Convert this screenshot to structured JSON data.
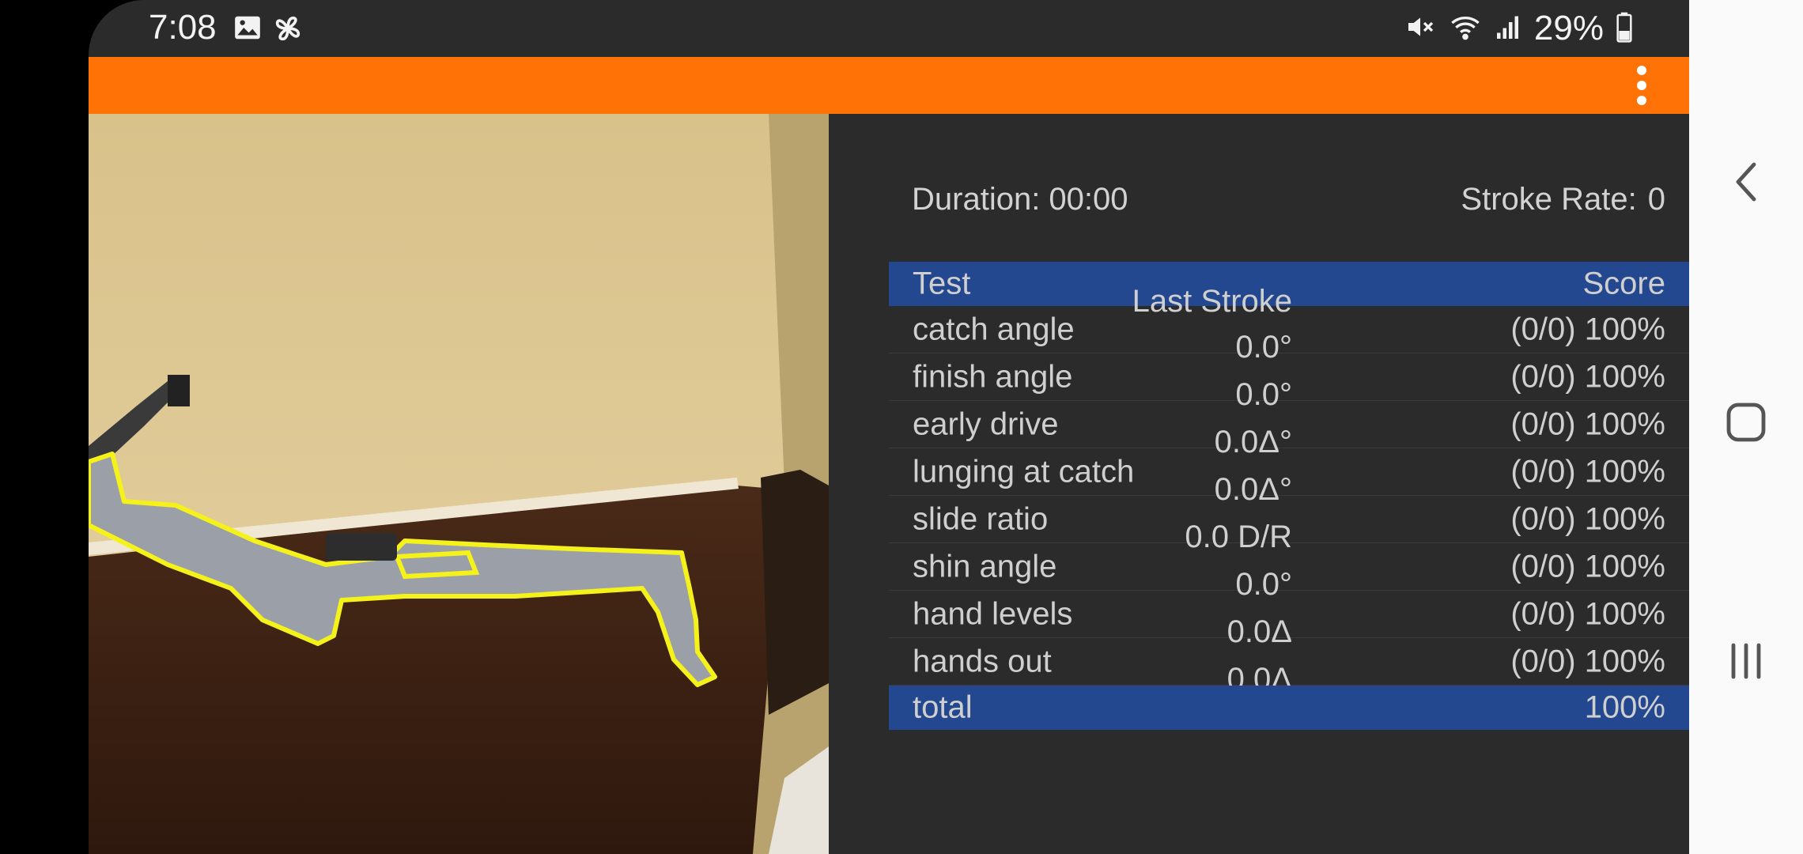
{
  "status_bar": {
    "time": "7:08",
    "battery_percent": "29%",
    "icons": [
      "image-icon",
      "pinwheel-icon",
      "mute-icon",
      "wifi-icon",
      "signal-icon",
      "battery-icon"
    ]
  },
  "toolbar": {
    "accent_color": "#ff7306",
    "menu_icon": "more-vert-icon"
  },
  "stats": {
    "duration_label": "Duration: 00:00",
    "stroke_rate_label": "Stroke Rate:",
    "stroke_rate_value": "0"
  },
  "table": {
    "header_color": "#24488f",
    "headers": {
      "test": "Test",
      "last_stroke": "Last Stroke",
      "score": "Score"
    },
    "rows": [
      {
        "test": "catch angle",
        "last_stroke": "0.0°",
        "score": "(0/0) 100%"
      },
      {
        "test": "finish angle",
        "last_stroke": "0.0°",
        "score": "(0/0) 100%"
      },
      {
        "test": "early drive",
        "last_stroke": "0.0Δ°",
        "score": "(0/0) 100%"
      },
      {
        "test": "lunging at catch",
        "last_stroke": "0.0Δ°",
        "score": "(0/0) 100%"
      },
      {
        "test": "slide ratio",
        "last_stroke": "0.0 D/R",
        "score": "(0/0) 100%"
      },
      {
        "test": "shin angle",
        "last_stroke": "0.0°",
        "score": "(0/0) 100%"
      },
      {
        "test": "hand levels",
        "last_stroke": "0.0Δ",
        "score": "(0/0) 100%"
      },
      {
        "test": "hands out",
        "last_stroke": "0.0Δ",
        "score": "(0/0) 100%"
      }
    ],
    "total": {
      "label": "total",
      "score": "100%"
    }
  },
  "nav_bar": {
    "buttons": [
      "back-icon",
      "home-icon",
      "recents-icon"
    ]
  }
}
